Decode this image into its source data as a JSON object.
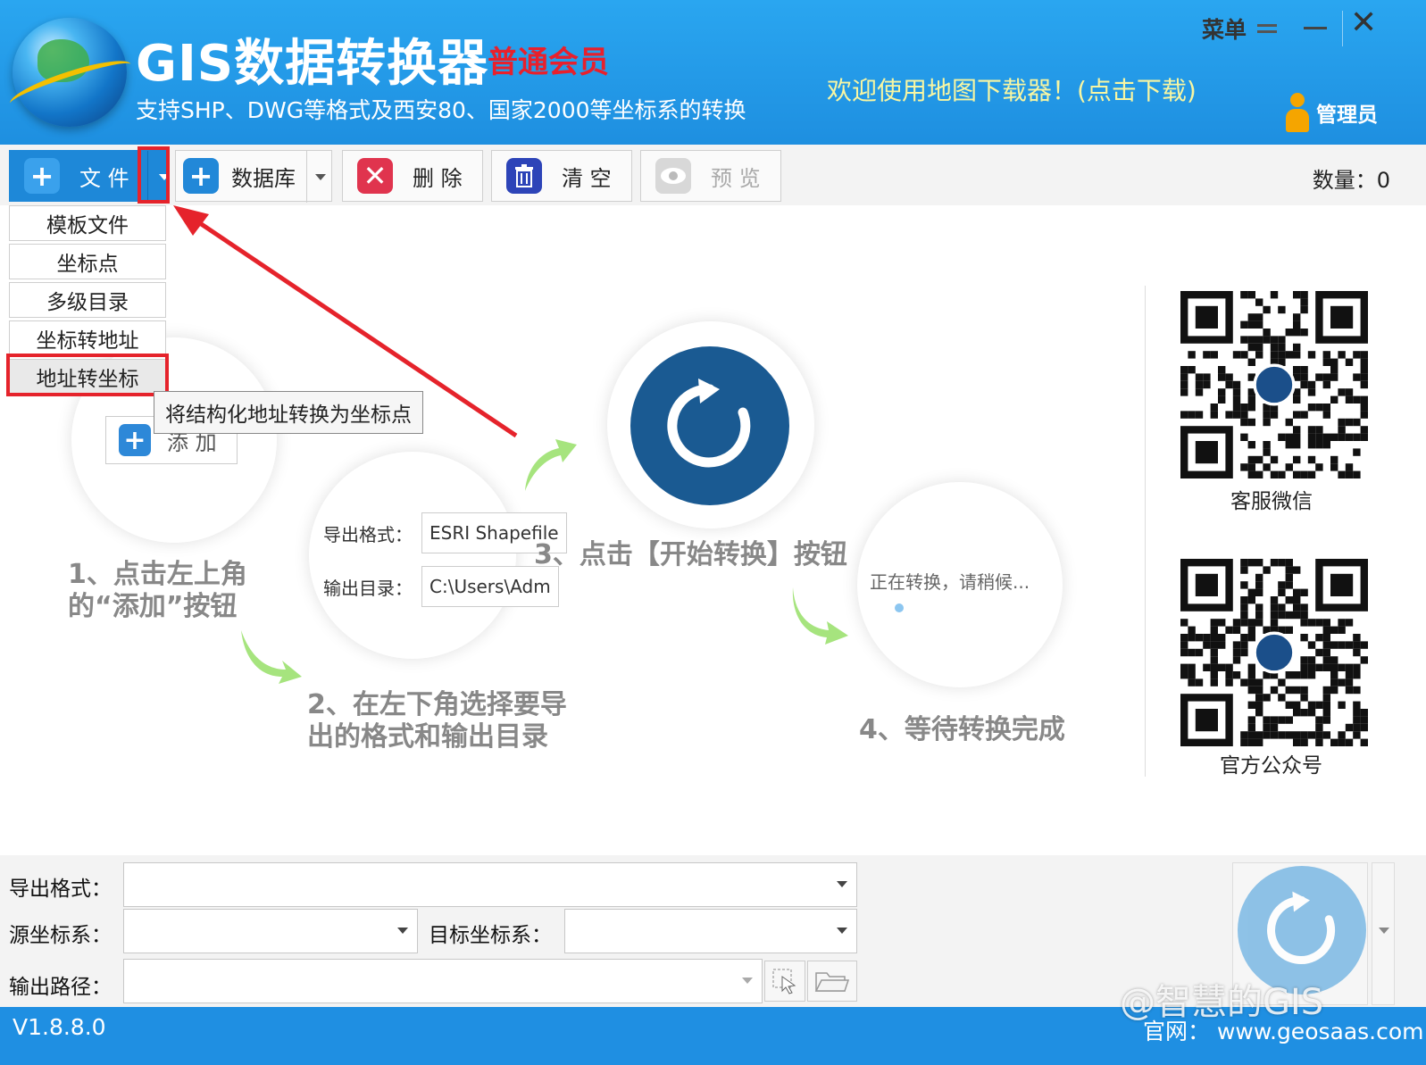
{
  "header": {
    "title": "GIS数据转换器",
    "member": "普通会员",
    "subtitle": "支持SHP、DWG等格式及西安80、国家2000等坐标系的转换",
    "welcome": "欢迎使用地图下载器！(点击下载)",
    "menu_label": "菜单",
    "admin_label": "管理员",
    "close_glyph": "✕"
  },
  "toolbar": {
    "file_label": "文 件",
    "database_label": "数据库",
    "delete_label": "删 除",
    "clear_label": "清 空",
    "preview_label": "预 览",
    "count_label": "数量：0"
  },
  "file_menu": {
    "items": [
      "模板文件",
      "坐标点",
      "多级目录",
      "坐标转地址",
      "地址转坐标"
    ],
    "tooltip": "将结构化地址转换为坐标点"
  },
  "guide": {
    "step1": [
      "1、点击左上角",
      "的“添加”按钮"
    ],
    "add_button": "添 加",
    "step2": [
      "2、在左下角选择要导",
      "出的格式和输出目录"
    ],
    "export_format_label": "导出格式：",
    "export_format_value": "ESRI Shapefile",
    "output_dir_label": "输出目录：",
    "output_dir_value": "C:\\Users\\Adm",
    "step3": "3、点击【开始转换】按钮",
    "converting": "正在转换，请稍候...",
    "step4": "4、等待转换完成"
  },
  "qr": {
    "wechat_label": "客服微信",
    "official_label": "官方公众号"
  },
  "form": {
    "export_format_label": "导出格式：",
    "source_crs_label": "源坐标系：",
    "target_crs_label": "目标坐标系：",
    "output_path_label": "输出路径："
  },
  "status": {
    "version": "V1.8.8.0",
    "site": "官网：  www.geosaas.com",
    "watermark": "@智慧的GIS"
  },
  "colors": {
    "header_blue": "#1e8fe0",
    "member_red": "#e8202c",
    "highlight_red": "#e5232b",
    "arrow_green": "#9fe07a"
  }
}
